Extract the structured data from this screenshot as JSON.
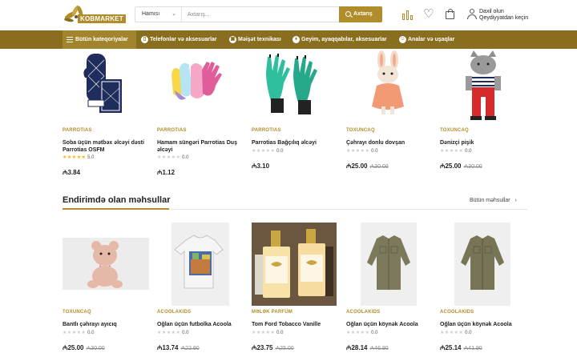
{
  "header": {
    "logo_text": "KOBMARKET",
    "search_category": "Hamısı",
    "search_placeholder": "Axtarış...",
    "search_button": "Axtarış",
    "login_line1": "Daxil olun",
    "login_line2": "Qeydiyyatdan keçin"
  },
  "nav": {
    "all_categories": "Bütün kateqoriyalar",
    "items": [
      {
        "label": "Telefonlar və aksesuarlar",
        "icon": "phone-icon"
      },
      {
        "label": "Məişət texnikası",
        "icon": "appliance-icon"
      },
      {
        "label": "Geyim, ayaqqabılar, aksesuarlar",
        "icon": "clothing-icon"
      },
      {
        "label": "Analar və uşaqlar",
        "icon": "baby-icon"
      }
    ]
  },
  "top_products": [
    {
      "brand": "PARROTIAS",
      "name": "Soba üçün mətbəx əlcəyi dəsti Parrotias OSFM",
      "rating": "5.0",
      "stars": 5,
      "price": "₼3.84",
      "old_price": ""
    },
    {
      "brand": "PARROTIAS",
      "name": "Hamam süngəri Parrotias Duş əlcəyi",
      "rating": "0.0",
      "stars": 0,
      "price": "₼1.12",
      "old_price": ""
    },
    {
      "brand": "PARROTIAS",
      "name": "Parrotias Bağçılıq əlcəyi",
      "rating": "0.0",
      "stars": 0,
      "price": "₼3.10",
      "old_price": ""
    },
    {
      "brand": "TOXUNCAQ",
      "name": "Çəhrayı donlu dovşan",
      "rating": "0.0",
      "stars": 0,
      "price": "₼25.00",
      "old_price": "₼30.00"
    },
    {
      "brand": "TOXUNCAQ",
      "name": "Dənizçi pişik",
      "rating": "0.0",
      "stars": 0,
      "price": "₼25.00",
      "old_price": "₼30.00"
    }
  ],
  "discount_section": {
    "title": "Endirimdə olan məhsullar",
    "all_link": "Bütün məhsullar"
  },
  "discount_products": [
    {
      "brand": "TOXUNCAQ",
      "name": "Bantlı çəhrayı ayıcıq",
      "rating": "0.0",
      "stars": 0,
      "price": "₼25.00",
      "old_price": "₼30.00"
    },
    {
      "brand": "ACOOLAKIDS",
      "name": "Oğlan üçün futbolka Acoola",
      "rating": "0.0",
      "stars": 0,
      "price": "₼13.74",
      "old_price": "₼22.90"
    },
    {
      "brand": "MƏLƏK PARFÜM",
      "name": "Tom Ford Tobacco Vanille",
      "rating": "0.0",
      "stars": 0,
      "price": "₼23.75",
      "old_price": "₼25.00"
    },
    {
      "brand": "ACOOLAKIDS",
      "name": "Oğlan üçün köynək Acoola",
      "rating": "0.0",
      "stars": 0,
      "price": "₼28.14",
      "old_price": "₼46.90"
    },
    {
      "brand": "ACOOLAKIDS",
      "name": "Oğlan üçün köynək Acoola",
      "rating": "0.0",
      "stars": 0,
      "price": "₼25.14",
      "old_price": "₼41.90"
    }
  ],
  "colors": {
    "brand": "#b08d2a",
    "nav": "#8a6e1f",
    "star": "#f4b400"
  }
}
